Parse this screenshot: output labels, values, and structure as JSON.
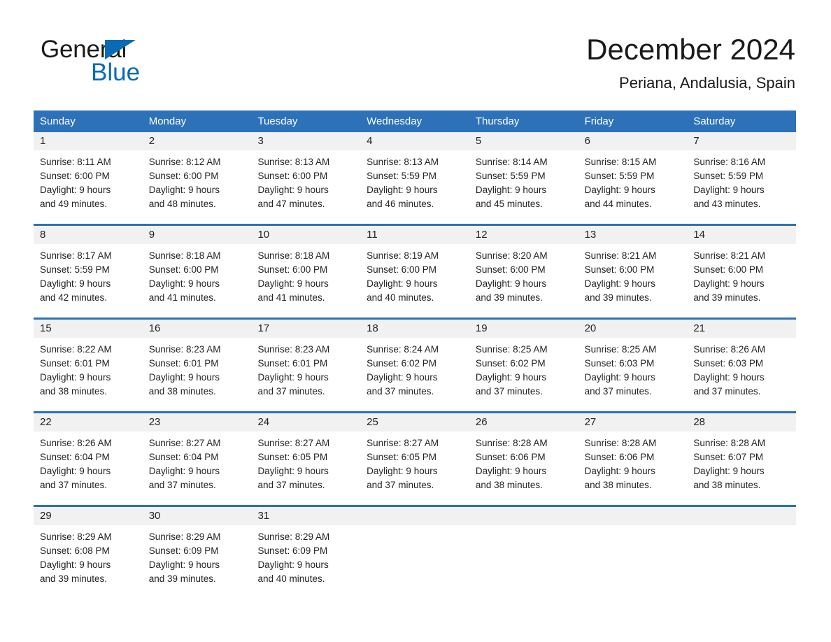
{
  "brand": {
    "word_one": "General",
    "word_two": "Blue",
    "triangle_icon": "brand-triangle-icon"
  },
  "header": {
    "title": "December 2024",
    "location": "Periana, Andalusia, Spain"
  },
  "colors": {
    "header_blue": "#2d72b8",
    "brand_blue": "#0a6ab4",
    "date_band_gray": "#f1f1f1",
    "text": "#232323"
  },
  "weekdays": [
    "Sunday",
    "Monday",
    "Tuesday",
    "Wednesday",
    "Thursday",
    "Friday",
    "Saturday"
  ],
  "weeks": [
    {
      "days": [
        {
          "date": "1",
          "lines": [
            "Sunrise: 8:11 AM",
            "Sunset: 6:00 PM",
            "Daylight: 9 hours",
            "and 49 minutes."
          ]
        },
        {
          "date": "2",
          "lines": [
            "Sunrise: 8:12 AM",
            "Sunset: 6:00 PM",
            "Daylight: 9 hours",
            "and 48 minutes."
          ]
        },
        {
          "date": "3",
          "lines": [
            "Sunrise: 8:13 AM",
            "Sunset: 6:00 PM",
            "Daylight: 9 hours",
            "and 47 minutes."
          ]
        },
        {
          "date": "4",
          "lines": [
            "Sunrise: 8:13 AM",
            "Sunset: 5:59 PM",
            "Daylight: 9 hours",
            "and 46 minutes."
          ]
        },
        {
          "date": "5",
          "lines": [
            "Sunrise: 8:14 AM",
            "Sunset: 5:59 PM",
            "Daylight: 9 hours",
            "and 45 minutes."
          ]
        },
        {
          "date": "6",
          "lines": [
            "Sunrise: 8:15 AM",
            "Sunset: 5:59 PM",
            "Daylight: 9 hours",
            "and 44 minutes."
          ]
        },
        {
          "date": "7",
          "lines": [
            "Sunrise: 8:16 AM",
            "Sunset: 5:59 PM",
            "Daylight: 9 hours",
            "and 43 minutes."
          ]
        }
      ]
    },
    {
      "days": [
        {
          "date": "8",
          "lines": [
            "Sunrise: 8:17 AM",
            "Sunset: 5:59 PM",
            "Daylight: 9 hours",
            "and 42 minutes."
          ]
        },
        {
          "date": "9",
          "lines": [
            "Sunrise: 8:18 AM",
            "Sunset: 6:00 PM",
            "Daylight: 9 hours",
            "and 41 minutes."
          ]
        },
        {
          "date": "10",
          "lines": [
            "Sunrise: 8:18 AM",
            "Sunset: 6:00 PM",
            "Daylight: 9 hours",
            "and 41 minutes."
          ]
        },
        {
          "date": "11",
          "lines": [
            "Sunrise: 8:19 AM",
            "Sunset: 6:00 PM",
            "Daylight: 9 hours",
            "and 40 minutes."
          ]
        },
        {
          "date": "12",
          "lines": [
            "Sunrise: 8:20 AM",
            "Sunset: 6:00 PM",
            "Daylight: 9 hours",
            "and 39 minutes."
          ]
        },
        {
          "date": "13",
          "lines": [
            "Sunrise: 8:21 AM",
            "Sunset: 6:00 PM",
            "Daylight: 9 hours",
            "and 39 minutes."
          ]
        },
        {
          "date": "14",
          "lines": [
            "Sunrise: 8:21 AM",
            "Sunset: 6:00 PM",
            "Daylight: 9 hours",
            "and 39 minutes."
          ]
        }
      ]
    },
    {
      "days": [
        {
          "date": "15",
          "lines": [
            "Sunrise: 8:22 AM",
            "Sunset: 6:01 PM",
            "Daylight: 9 hours",
            "and 38 minutes."
          ]
        },
        {
          "date": "16",
          "lines": [
            "Sunrise: 8:23 AM",
            "Sunset: 6:01 PM",
            "Daylight: 9 hours",
            "and 38 minutes."
          ]
        },
        {
          "date": "17",
          "lines": [
            "Sunrise: 8:23 AM",
            "Sunset: 6:01 PM",
            "Daylight: 9 hours",
            "and 37 minutes."
          ]
        },
        {
          "date": "18",
          "lines": [
            "Sunrise: 8:24 AM",
            "Sunset: 6:02 PM",
            "Daylight: 9 hours",
            "and 37 minutes."
          ]
        },
        {
          "date": "19",
          "lines": [
            "Sunrise: 8:25 AM",
            "Sunset: 6:02 PM",
            "Daylight: 9 hours",
            "and 37 minutes."
          ]
        },
        {
          "date": "20",
          "lines": [
            "Sunrise: 8:25 AM",
            "Sunset: 6:03 PM",
            "Daylight: 9 hours",
            "and 37 minutes."
          ]
        },
        {
          "date": "21",
          "lines": [
            "Sunrise: 8:26 AM",
            "Sunset: 6:03 PM",
            "Daylight: 9 hours",
            "and 37 minutes."
          ]
        }
      ]
    },
    {
      "days": [
        {
          "date": "22",
          "lines": [
            "Sunrise: 8:26 AM",
            "Sunset: 6:04 PM",
            "Daylight: 9 hours",
            "and 37 minutes."
          ]
        },
        {
          "date": "23",
          "lines": [
            "Sunrise: 8:27 AM",
            "Sunset: 6:04 PM",
            "Daylight: 9 hours",
            "and 37 minutes."
          ]
        },
        {
          "date": "24",
          "lines": [
            "Sunrise: 8:27 AM",
            "Sunset: 6:05 PM",
            "Daylight: 9 hours",
            "and 37 minutes."
          ]
        },
        {
          "date": "25",
          "lines": [
            "Sunrise: 8:27 AM",
            "Sunset: 6:05 PM",
            "Daylight: 9 hours",
            "and 37 minutes."
          ]
        },
        {
          "date": "26",
          "lines": [
            "Sunrise: 8:28 AM",
            "Sunset: 6:06 PM",
            "Daylight: 9 hours",
            "and 38 minutes."
          ]
        },
        {
          "date": "27",
          "lines": [
            "Sunrise: 8:28 AM",
            "Sunset: 6:06 PM",
            "Daylight: 9 hours",
            "and 38 minutes."
          ]
        },
        {
          "date": "28",
          "lines": [
            "Sunrise: 8:28 AM",
            "Sunset: 6:07 PM",
            "Daylight: 9 hours",
            "and 38 minutes."
          ]
        }
      ]
    },
    {
      "days": [
        {
          "date": "29",
          "lines": [
            "Sunrise: 8:29 AM",
            "Sunset: 6:08 PM",
            "Daylight: 9 hours",
            "and 39 minutes."
          ]
        },
        {
          "date": "30",
          "lines": [
            "Sunrise: 8:29 AM",
            "Sunset: 6:09 PM",
            "Daylight: 9 hours",
            "and 39 minutes."
          ]
        },
        {
          "date": "31",
          "lines": [
            "Sunrise: 8:29 AM",
            "Sunset: 6:09 PM",
            "Daylight: 9 hours",
            "and 40 minutes."
          ]
        },
        {
          "date": "",
          "lines": []
        },
        {
          "date": "",
          "lines": []
        },
        {
          "date": "",
          "lines": []
        },
        {
          "date": "",
          "lines": []
        }
      ]
    }
  ]
}
